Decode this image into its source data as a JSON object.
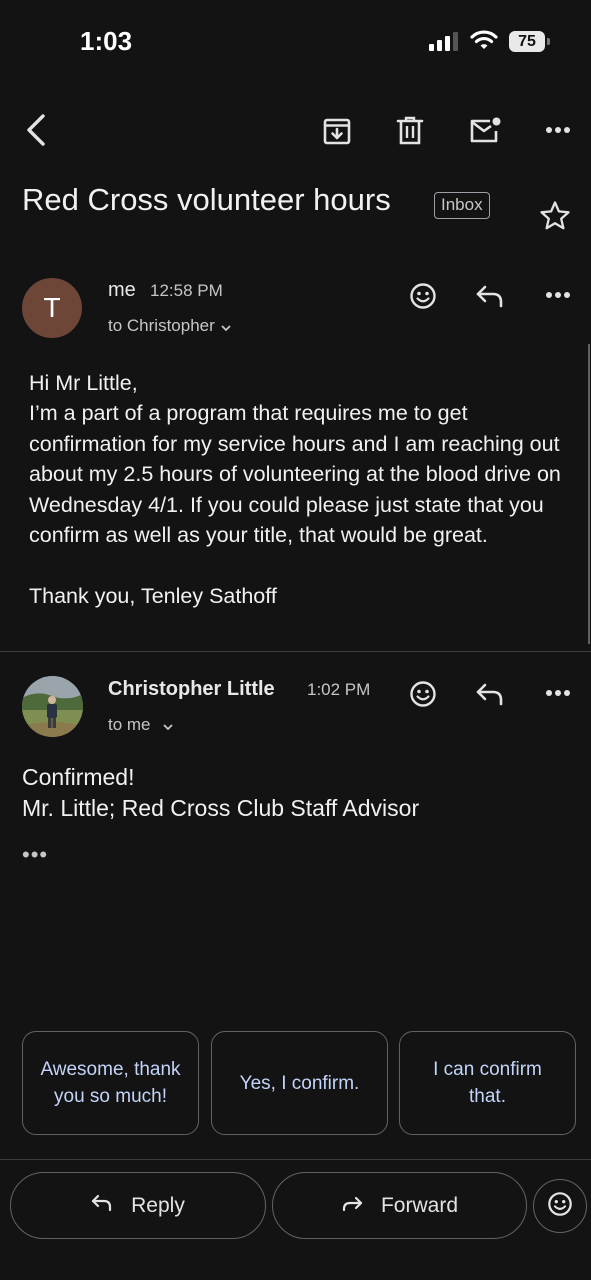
{
  "status_bar": {
    "time": "1:03",
    "battery": "75"
  },
  "toolbar": {
    "icons": [
      "back-arrow-icon",
      "archive-icon",
      "delete-icon",
      "mark-unread-icon",
      "more-options-icon"
    ]
  },
  "thread": {
    "subject": "Red Cross volunteer hours",
    "label": "Inbox"
  },
  "messages": [
    {
      "avatar_initial": "T",
      "avatar_color": "#6d4638",
      "sender": "me",
      "time": "12:58 PM",
      "recipient": "to Christopher",
      "body": "Hi Mr Little,\nI’m a part of a program that requires me to get confirmation for my service hours and I am reaching out about my 2.5 hours of volunteering at the blood drive on Wednesday 4/1. If you could please just state that you confirm as well as your title, that would be great.\n\nThank you, Tenley Sathoff"
    },
    {
      "sender": "Christopher Little",
      "time": "1:02 PM",
      "recipient": "to me",
      "body": "Confirmed!\nMr. Little; Red Cross Club Staff Advisor",
      "trimmed_indicator": "•••"
    }
  ],
  "smart_replies": [
    "Awesome, thank you so much!",
    "Yes, I confirm.",
    "I can confirm that."
  ],
  "actions": {
    "reply": "Reply",
    "forward": "Forward"
  },
  "colors": {
    "background": "#131314",
    "accent_text": "#c2d4f7",
    "divider": "#3c3c3f"
  }
}
